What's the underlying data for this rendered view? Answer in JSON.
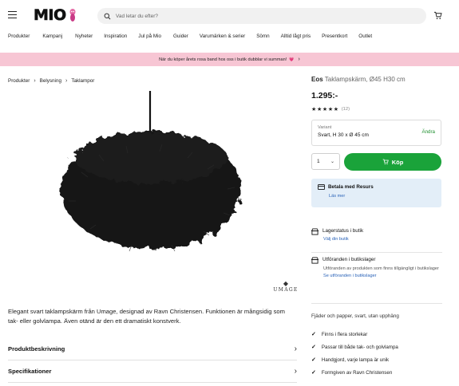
{
  "header": {
    "logo_text": "MIO",
    "search_placeholder": "Vad letar du efter?"
  },
  "nav": {
    "items": [
      "Produkter",
      "Kampanj",
      "Nyheter",
      "Inspiration",
      "Jul på Mio",
      "Guider",
      "Varumärken & serier",
      "Sömn",
      "Alltid lågt pris",
      "Presentkort",
      "Outlet"
    ]
  },
  "banner": {
    "text": "När du köper årets rosa band hos oss i butik dubblar vi summan!",
    "heart": "💗",
    "arrow": "›"
  },
  "breadcrumb": {
    "items": [
      "Produkter",
      "Belysning",
      "Taklampor"
    ]
  },
  "brand": {
    "logo_word": "UMAGE"
  },
  "product": {
    "name": "Eos",
    "subtitle": "Taklampskärm, Ø45 H30 cm",
    "price": "1.295:-",
    "stars": "★★★★★",
    "review_count": "(12)",
    "rating": 5,
    "description": "Elegant svart taklampskärm från Umage, designad av Ravn Christensen. Funktionen är mångsidig som tak- eller golvlampa. Även otänd är den ett dramatiskt konstverk."
  },
  "variant": {
    "label": "Variant",
    "value": "Svart, H 30 x Ø 45 cm",
    "change": "Ändra"
  },
  "purchase": {
    "quantity": "1",
    "buy_label": "Köp"
  },
  "resurs": {
    "title": "Betala med Resurs",
    "link": "Läs mer"
  },
  "stock": {
    "title": "Lagerstatus i butik",
    "link": "Välj din butik"
  },
  "showroom": {
    "title": "Utföranden i butikslager",
    "text": "Utföranden av produkten som finns tillgängligt i butikslager",
    "link": "Se utföranden i butikslager"
  },
  "accordions": {
    "description": "Produktbeskrivning",
    "specs": "Specifikationer"
  },
  "features": {
    "title": "Fjäder och papper, svart, utan upphäng",
    "items": [
      "Finns i flera storlekar",
      "Passar till både tak- och golvlampa",
      "Handgjord, varje lampa är unik",
      "Formgiven av Ravn Christensen"
    ]
  },
  "colors": {
    "banner_bg": "#f7c6d4",
    "buy_green": "#1aa33a",
    "link_blue": "#2a63b8",
    "resurs_bg": "#e3eef8"
  }
}
